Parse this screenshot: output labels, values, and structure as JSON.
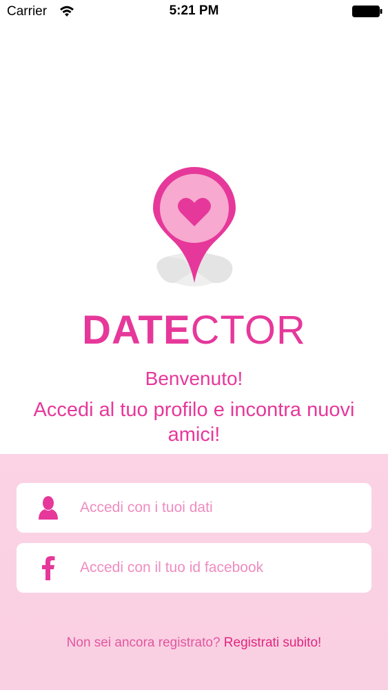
{
  "status_bar": {
    "carrier": "Carrier",
    "time": "5:21 PM",
    "wifi_icon": "wifi-icon",
    "battery_icon": "battery-icon"
  },
  "brand": {
    "bold_part": "DATE",
    "light_part": "CTOR",
    "pin_icon": "map-pin-heart-icon",
    "color": "#e6389a"
  },
  "welcome": {
    "title": "Benvenuto!",
    "subtitle": "Accedi al tuo profilo e incontra nuovi amici!"
  },
  "login": {
    "credentials_label": "Accedi con i tuoi dati",
    "credentials_icon": "user-icon",
    "facebook_label": "Accedi con il tuo id facebook",
    "facebook_icon": "facebook-icon"
  },
  "register": {
    "question": "Non sei ancora registrato?",
    "link": "Registrati subito!"
  },
  "colors": {
    "accent": "#e6389a",
    "panel": "#fbd3e4",
    "button_text": "#ef8cc0"
  }
}
